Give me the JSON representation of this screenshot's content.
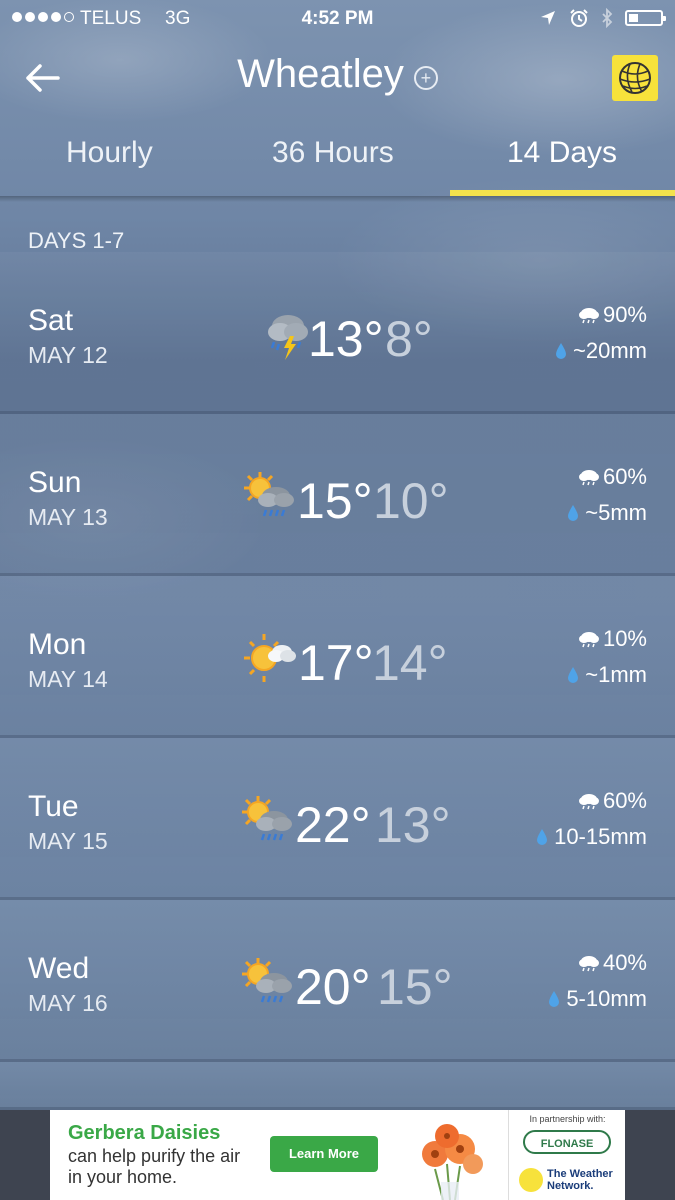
{
  "status_bar": {
    "carrier": "TELUS",
    "network": "3G",
    "time": "4:52 PM"
  },
  "header": {
    "city": "Wheatley"
  },
  "tabs": [
    {
      "label": "Hourly",
      "active": false
    },
    {
      "label": "36 Hours",
      "active": false
    },
    {
      "label": "14 Days",
      "active": true
    }
  ],
  "section_label": "DAYS 1-7",
  "days": [
    {
      "day": "Sat",
      "date": "MAY 12",
      "icon": "thunderstorm-icon",
      "high": "13°",
      "low": "8°",
      "pop": "90%",
      "precip": "~20mm"
    },
    {
      "day": "Sun",
      "date": "MAY 13",
      "icon": "sun-cloud-rain-icon",
      "high": "15°",
      "low": "10°",
      "pop": "60%",
      "precip": "~5mm"
    },
    {
      "day": "Mon",
      "date": "MAY 14",
      "icon": "sun-cloud-icon",
      "high": "17°",
      "low": "14°",
      "pop": "10%",
      "precip": "~1mm"
    },
    {
      "day": "Tue",
      "date": "MAY 15",
      "icon": "sun-cloud-rain-icon",
      "high": "22°",
      "low": "13°",
      "pop": "60%",
      "precip": "10-15mm"
    },
    {
      "day": "Wed",
      "date": "MAY 16",
      "icon": "sun-cloud-rain-icon",
      "high": "20°",
      "low": "15°",
      "pop": "40%",
      "precip": "5-10mm"
    }
  ],
  "ad": {
    "title": "Gerbera Daisies",
    "text": "can help purify the air in your home.",
    "button": "Learn More",
    "partner_label": "In partnership with:",
    "partner_brand": "FLONASE",
    "network_name": "The Weather Network."
  },
  "colors": {
    "tab_underline": "#f4e24c",
    "logo_bg": "#f7e23b",
    "ad_green": "#3aa847"
  }
}
